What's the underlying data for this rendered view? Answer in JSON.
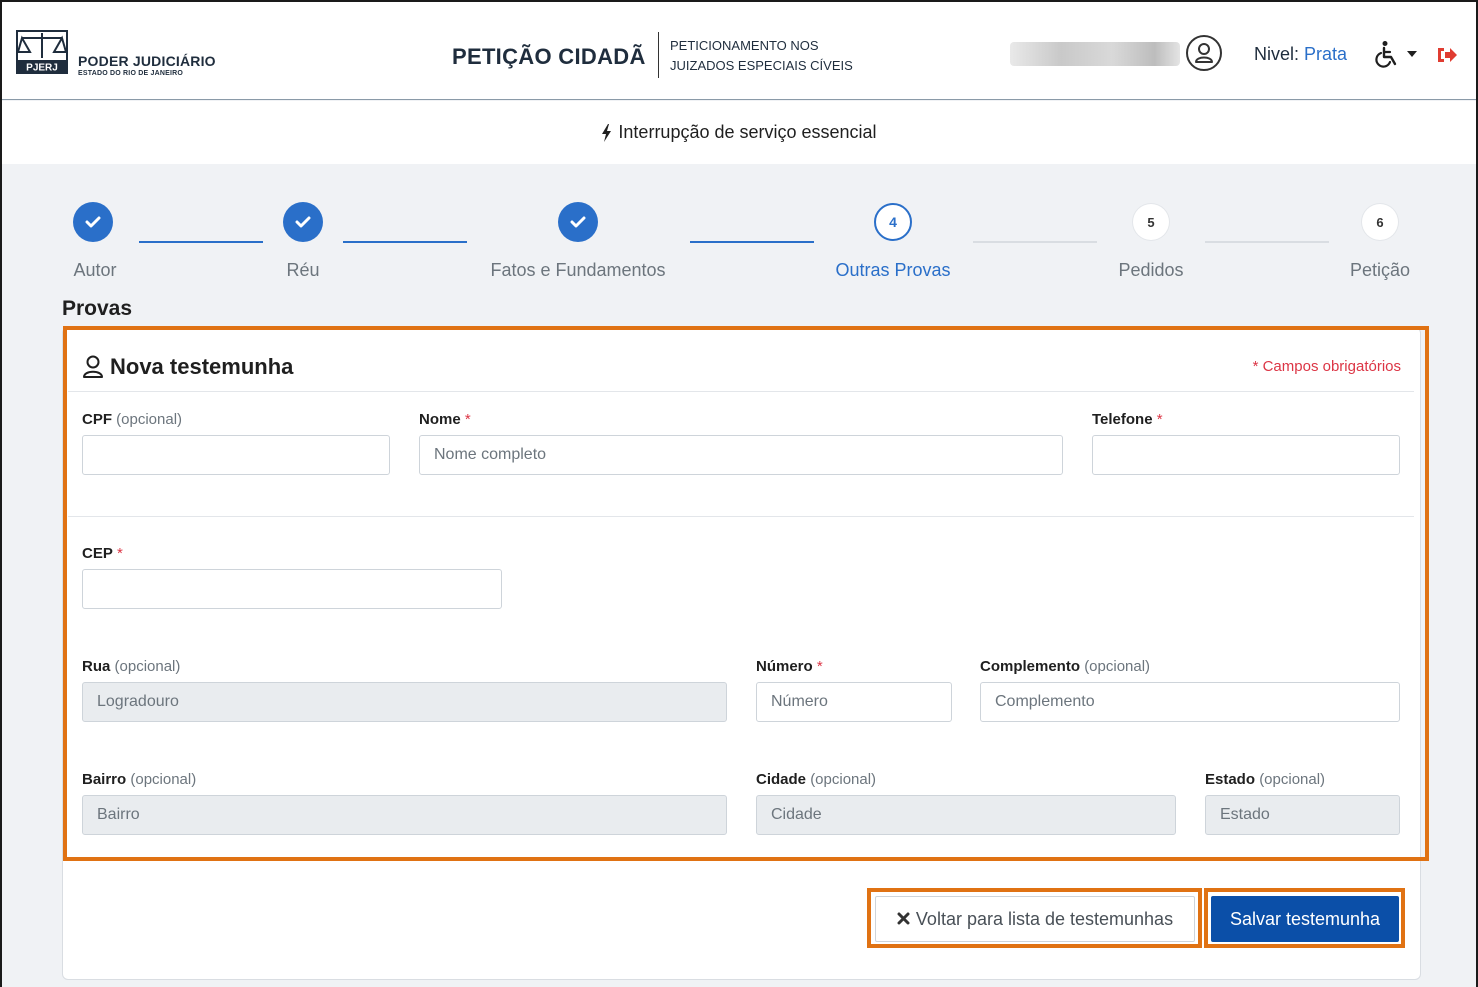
{
  "header": {
    "logo_title": "PODER JUDICIÁRIO",
    "logo_sub": "ESTADO DO RIO DE JANEIRO",
    "logo_mark_text": "PJERJ",
    "app_title": "PETIÇÃO CIDADÃ",
    "app_sub_line1": "PETICIONAMENTO NOS",
    "app_sub_line2": "JUIZADOS ESPECIAIS CÍVEIS",
    "nivel_label": "Nivel:",
    "nivel_value": "Prata",
    "icons": [
      "user-icon",
      "accessibility-icon",
      "caret-down-icon",
      "logout-icon"
    ]
  },
  "alert": {
    "text": "Interrupção de serviço essencial",
    "icon": "bolt-icon"
  },
  "stepper": {
    "steps": [
      {
        "label": "Autor",
        "state": "done"
      },
      {
        "label": "Réu",
        "state": "done"
      },
      {
        "label": "Fatos e Fundamentos",
        "state": "done"
      },
      {
        "label": "Outras Provas",
        "state": "active",
        "number": "4"
      },
      {
        "label": "Pedidos",
        "state": "todo",
        "number": "5"
      },
      {
        "label": "Petição",
        "state": "todo",
        "number": "6"
      }
    ]
  },
  "section_title": "Provas",
  "form": {
    "title": "Nova testemunha",
    "required_note": "* Campos obrigatórios",
    "optional_tag": "(opcional)",
    "required_mark": "*",
    "fields": {
      "cpf": {
        "label": "CPF",
        "placeholder": "",
        "value": ""
      },
      "nome": {
        "label": "Nome",
        "placeholder": "Nome completo",
        "value": ""
      },
      "telefone": {
        "label": "Telefone",
        "placeholder": "",
        "value": ""
      },
      "cep": {
        "label": "CEP",
        "placeholder": "",
        "value": ""
      },
      "rua": {
        "label": "Rua",
        "placeholder": "Logradouro",
        "value": ""
      },
      "numero": {
        "label": "Número",
        "placeholder": "Número",
        "value": ""
      },
      "complemento": {
        "label": "Complemento",
        "placeholder": "Complemento",
        "value": ""
      },
      "bairro": {
        "label": "Bairro",
        "placeholder": "Bairro",
        "value": ""
      },
      "cidade": {
        "label": "Cidade",
        "placeholder": "Cidade",
        "value": ""
      },
      "estado": {
        "label": "Estado",
        "placeholder": "Estado",
        "value": ""
      }
    }
  },
  "actions": {
    "back_label": "Voltar para lista de testemunhas",
    "back_icon": "x-icon",
    "save_label": "Salvar testemunha"
  },
  "colors": {
    "primary": "#2a6fc9",
    "save_button": "#0b4fa8",
    "highlight": "#e07213",
    "required": "#dc3545",
    "logout": "#e03c31"
  }
}
